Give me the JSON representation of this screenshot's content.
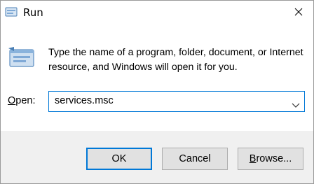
{
  "window": {
    "title": "Run",
    "title_icon": "run-app-icon",
    "close_icon": "close-icon"
  },
  "body": {
    "description": "Type the name of a program, folder, document, or Internet resource, and Windows will open it for you.",
    "icon": "run-icon"
  },
  "open": {
    "label_accel": "O",
    "label_rest": "pen:",
    "value": "services.msc",
    "dropdown_icon": "chevron-down-icon"
  },
  "buttons": {
    "ok": "OK",
    "cancel": "Cancel",
    "browse_accel": "B",
    "browse_rest": "rowse..."
  },
  "colors": {
    "accent": "#0078d7",
    "footer_bg": "#f0f0f0",
    "button_bg": "#e1e1e1"
  }
}
